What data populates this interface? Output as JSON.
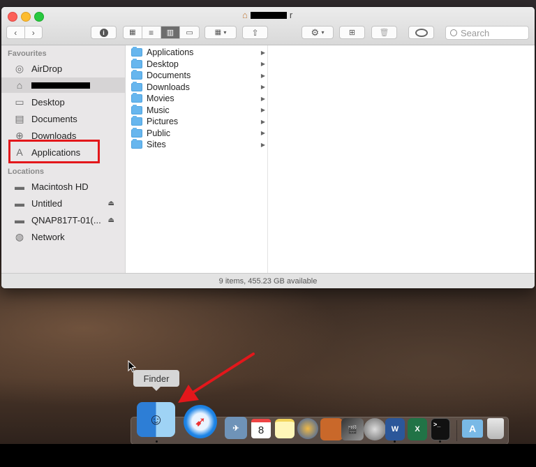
{
  "window": {
    "title_suffix": "r",
    "status": "9 items, 455.23 GB available"
  },
  "toolbar": {
    "search_placeholder": "Search"
  },
  "sidebar": {
    "favourites_header": "Favourites",
    "locations_header": "Locations",
    "favourites": [
      {
        "label": "AirDrop",
        "icon": "airdrop-icon"
      },
      {
        "label": "",
        "icon": "home-icon"
      },
      {
        "label": "Desktop",
        "icon": "desktop-icon"
      },
      {
        "label": "Documents",
        "icon": "documents-icon"
      },
      {
        "label": "Downloads",
        "icon": "downloads-icon"
      },
      {
        "label": "Applications",
        "icon": "applications-icon"
      }
    ],
    "locations": [
      {
        "label": "Macintosh HD",
        "icon": "disk-icon"
      },
      {
        "label": "Untitled",
        "icon": "disk-icon"
      },
      {
        "label": "QNAP817T-01(...",
        "icon": "server-icon"
      },
      {
        "label": "Network",
        "icon": "globe-icon"
      }
    ]
  },
  "column": {
    "items": [
      "Applications",
      "Desktop",
      "Documents",
      "Downloads",
      "Movies",
      "Music",
      "Pictures",
      "Public",
      "Sites"
    ]
  },
  "dock": {
    "tooltip": "Finder",
    "calendar_day": "8"
  },
  "colors": {
    "annotation_red": "#e3171b",
    "folder_blue": "#67b6ee"
  }
}
